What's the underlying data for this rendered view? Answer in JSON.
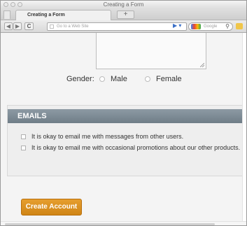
{
  "window": {
    "title": "Creating a Form"
  },
  "tabs": [
    {
      "label": "Creating a Form"
    }
  ],
  "toolbar": {
    "new_tab_label": "+",
    "back_label": "◀",
    "forward_label": "▶",
    "reload_label": "C",
    "url_placeholder": "Go to a Web Site",
    "go_label": "▶ ▾",
    "search_placeholder": "Google"
  },
  "form": {
    "gender": {
      "label": "Gender:",
      "options": [
        "Male",
        "Female"
      ]
    },
    "emails_section": {
      "title": "EMAILS",
      "checkboxes": [
        "It is okay to email me with messages from other users.",
        "It is okay to email me with occasional promotions about our other products."
      ]
    },
    "submit_label": "Create Account"
  },
  "colors": {
    "accent_button": "#d98c1f",
    "section_header": "#7d8a94"
  }
}
